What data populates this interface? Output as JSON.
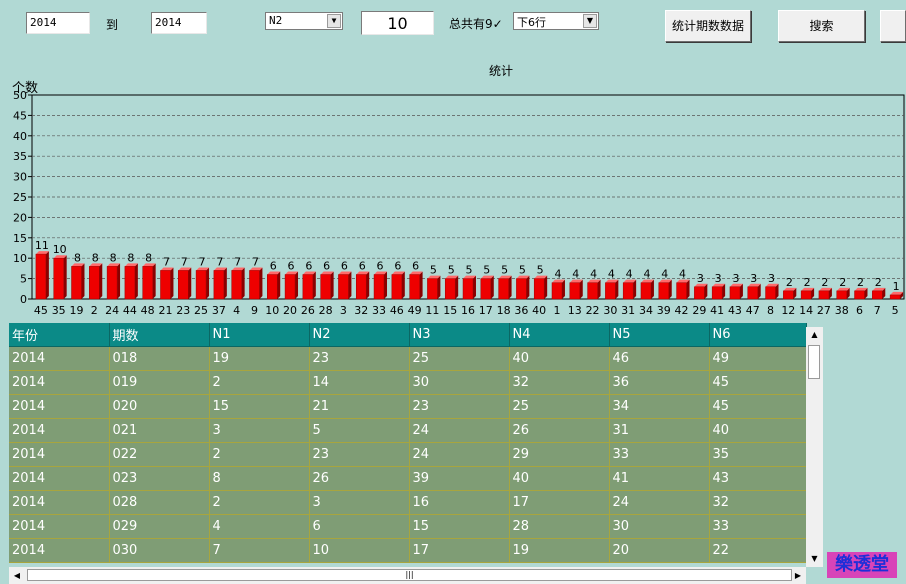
{
  "toolbar": {
    "from_year": "2014",
    "to_label": "到",
    "to_year": "2014",
    "column_select": "N2",
    "count_value": "10",
    "total_label": "总共有9✓",
    "rows_select": "下6行",
    "stats_button": "统计期数数据",
    "search_button": "搜索"
  },
  "chart_data": {
    "type": "bar",
    "title": "统计",
    "ylabel": "个数",
    "xlabel": "",
    "ylim": [
      0,
      50
    ],
    "yticks": [
      0,
      5,
      10,
      15,
      20,
      25,
      30,
      35,
      40,
      45,
      50
    ],
    "grid": true,
    "categories": [
      "45",
      "35",
      "19",
      "2",
      "24",
      "44",
      "48",
      "21",
      "23",
      "25",
      "37",
      "4",
      "9",
      "10",
      "20",
      "26",
      "28",
      "3",
      "32",
      "33",
      "46",
      "49",
      "11",
      "15",
      "16",
      "17",
      "18",
      "36",
      "40",
      "1",
      "13",
      "22",
      "30",
      "31",
      "34",
      "39",
      "42",
      "29",
      "41",
      "43",
      "47",
      "8",
      "12",
      "14",
      "27",
      "38",
      "6",
      "7",
      "5"
    ],
    "values": [
      11,
      10,
      8,
      8,
      8,
      8,
      8,
      7,
      7,
      7,
      7,
      7,
      7,
      6,
      6,
      6,
      6,
      6,
      6,
      6,
      6,
      6,
      5,
      5,
      5,
      5,
      5,
      5,
      5,
      4,
      4,
      4,
      4,
      4,
      4,
      4,
      4,
      3,
      3,
      3,
      3,
      3,
      2,
      2,
      2,
      2,
      2,
      2,
      1
    ],
    "bar_color": "#ee0000"
  },
  "grid": {
    "headers": [
      "年份",
      "期数",
      "N1",
      "N2",
      "N3",
      "N4",
      "N5",
      "N6"
    ],
    "rows": [
      [
        "2014",
        "018",
        "19",
        "23",
        "25",
        "40",
        "46",
        "49"
      ],
      [
        "2014",
        "019",
        "2",
        "14",
        "30",
        "32",
        "36",
        "45"
      ],
      [
        "2014",
        "020",
        "15",
        "21",
        "23",
        "25",
        "34",
        "45"
      ],
      [
        "2014",
        "021",
        "3",
        "5",
        "24",
        "26",
        "31",
        "40"
      ],
      [
        "2014",
        "022",
        "2",
        "23",
        "24",
        "29",
        "33",
        "35"
      ],
      [
        "2014",
        "023",
        "8",
        "26",
        "39",
        "40",
        "41",
        "43"
      ],
      [
        "2014",
        "028",
        "2",
        "3",
        "16",
        "17",
        "24",
        "32"
      ],
      [
        "2014",
        "029",
        "4",
        "6",
        "15",
        "28",
        "30",
        "33"
      ],
      [
        "2014",
        "030",
        "7",
        "10",
        "17",
        "19",
        "20",
        "22"
      ]
    ]
  },
  "brand": {
    "label": "樂透堂"
  }
}
